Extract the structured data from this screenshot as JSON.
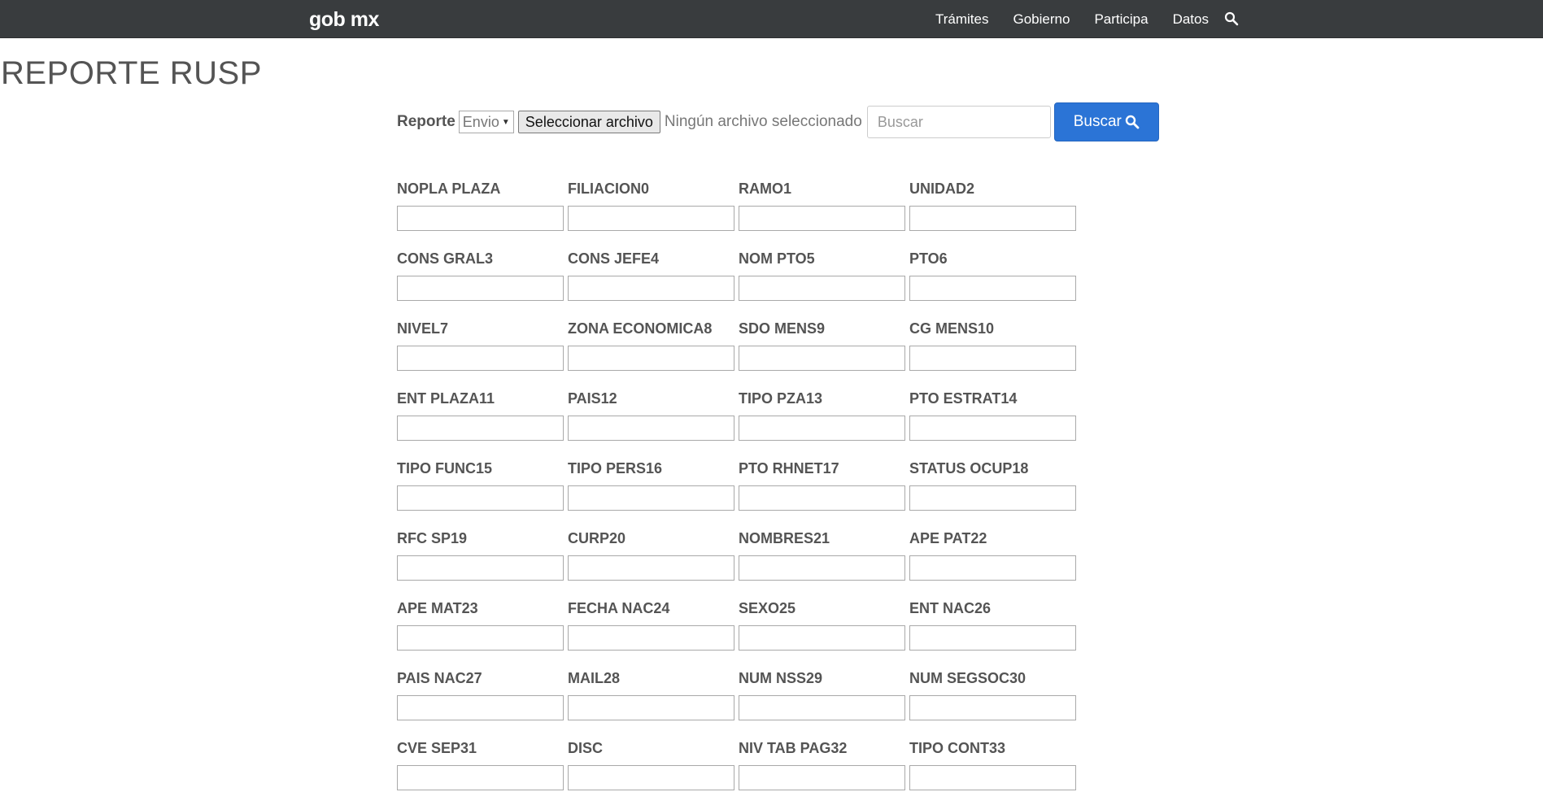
{
  "nav": {
    "logo": "gob mx",
    "links": [
      "Trámites",
      "Gobierno",
      "Participa",
      "Datos"
    ]
  },
  "page": {
    "title": "REPORTE RUSP"
  },
  "form": {
    "report_label": "Reporte",
    "select_value": "Envio",
    "file_button": "Seleccionar archivo",
    "file_status": "Ningún archivo seleccionado",
    "search_placeholder": "Buscar",
    "search_button": "Buscar"
  },
  "fields": [
    "NOPLA PLAZA",
    "FILIACION0",
    "RAMO1",
    "UNIDAD2",
    "CONS GRAL3",
    "CONS JEFE4",
    "NOM PTO5",
    "PTO6",
    "NIVEL7",
    "ZONA ECONOMICA8",
    "SDO MENS9",
    "CG MENS10",
    "ENT PLAZA11",
    "PAIS12",
    "TIPO PZA13",
    "PTO ESTRAT14",
    "TIPO FUNC15",
    "TIPO PERS16",
    "PTO RHNET17",
    "STATUS OCUP18",
    "RFC SP19",
    "CURP20",
    "NOMBRES21",
    "APE PAT22",
    "APE MAT23",
    "FECHA NAC24",
    "SEXO25",
    "ENT NAC26",
    "PAIS NAC27",
    "MAIL28",
    "NUM NSS29",
    "NUM SEGSOC30",
    "CVE SEP31",
    "DISC",
    "NIV TAB PAG32",
    "TIPO CONT33"
  ],
  "colors": {
    "navbar": "#393c3e",
    "accent": "#2b74d6",
    "text": "#545454"
  }
}
